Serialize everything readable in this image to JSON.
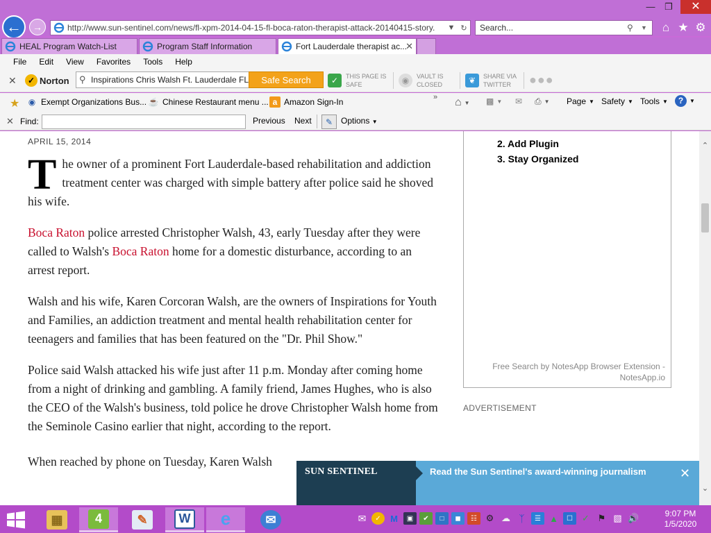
{
  "browser": {
    "address": "http://www.sun-sentinel.com/news/fl-xpm-2014-04-15-fl-boca-raton-therapist-attack-20140415-story.",
    "address_domain": "sun-sentinel.com",
    "search_placeholder": "Search...",
    "tabs": [
      {
        "label": "HEAL Program Watch-List"
      },
      {
        "label": "Program Staff Information"
      },
      {
        "label": "Fort Lauderdale therapist ac..."
      }
    ],
    "menu": [
      "File",
      "Edit",
      "View",
      "Favorites",
      "Tools",
      "Help"
    ]
  },
  "norton": {
    "logo": "Norton",
    "search_value": "Inspirations Chris Walsh Ft. Lauderdale FL",
    "safe_search": "Safe Search",
    "page_safe_line1": "THIS PAGE IS",
    "page_safe_line2": "SAFE",
    "vault_line1": "VAULT IS",
    "vault_line2": "CLOSED",
    "share_line1": "SHARE VIA",
    "share_line2": "TWITTER"
  },
  "favorites": [
    {
      "label": "Exempt Organizations Bus..."
    },
    {
      "label": "Chinese Restaurant menu ..."
    },
    {
      "label": "Amazon Sign-In"
    }
  ],
  "commands": {
    "page": "Page",
    "safety": "Safety",
    "tools": "Tools"
  },
  "findbar": {
    "label": "Find:",
    "previous": "Previous",
    "next": "Next",
    "options": "Options"
  },
  "article": {
    "date": "APRIL 15, 2014",
    "dropcap": "T",
    "p1": "he owner of a prominent Fort Lauderdale-based rehabilitation and addiction treatment center was charged with simple battery after police said he shoved his wife.",
    "p2_link1": "Boca Raton",
    "p2_a": " police arrested Christopher Walsh, 43, early Tuesday after they were called to Walsh's ",
    "p2_link2": "Boca Raton",
    "p2_b": " home for a domestic disturbance, according to an arrest report.",
    "p3": "Walsh and his wife, Karen Corcoran Walsh, are the owners of Inspirations for Youth and Families, an addiction treatment and mental health rehabilitation center for teenagers and families that has been featured on the \"Dr. Phil Show.\"",
    "p4": "Police said Walsh attacked his wife just after 11 p.m. Monday after coming home from a night of drinking and gambling. A family friend, James Hughes, who is also the CEO of the Walsh's business, told police he drove Christopher Walsh home from the Seminole Casino earlier that night, according to the report.",
    "p5": "When reached by phone on Tuesday, Karen Walsh"
  },
  "sidebar": {
    "items": [
      "2. Add Plugin",
      "3. Stay Organized"
    ],
    "credit": "Free Search by NotesApp Browser Extension - NotesApp.io",
    "ad_label": "ADVERTISEMENT"
  },
  "promo": {
    "brand": "SUN SENTINEL",
    "text": "Read the Sun Sentinel's award-winning journalism"
  },
  "clock": {
    "time": "9:07 PM",
    "date": "1/5/2020"
  },
  "colors": {
    "chrome": "#c06fd6",
    "taskbar": "#b34bc9",
    "link": "#c8102e",
    "promo": "#5aa9d8",
    "promo_dark": "#1d3e52"
  }
}
